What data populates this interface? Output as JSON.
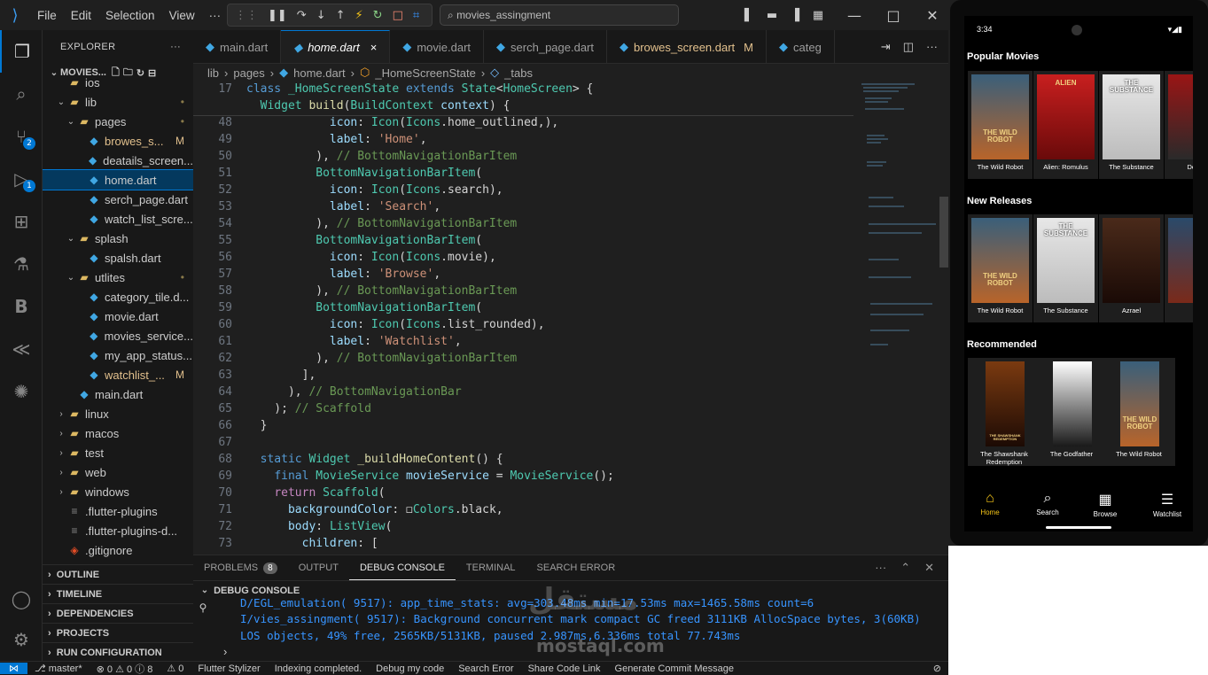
{
  "titlebar": {
    "menu": [
      "File",
      "Edit",
      "Selection",
      "View",
      "···"
    ],
    "search": "movies_assingment"
  },
  "explorer": {
    "title": "EXPLORER",
    "root": "MOVIES...",
    "rows": [
      {
        "indent": 2,
        "chev": "",
        "icon": "folder",
        "label": "ios",
        "mod": ""
      },
      {
        "indent": 2,
        "chev": "⌄",
        "icon": "folder",
        "label": "lib",
        "mod": "•"
      },
      {
        "indent": 3,
        "chev": "⌄",
        "icon": "folder",
        "label": "pages",
        "mod": "•"
      },
      {
        "indent": 4,
        "chev": "",
        "icon": "dart",
        "label": "browes_s...",
        "mod": "M"
      },
      {
        "indent": 4,
        "chev": "",
        "icon": "dart",
        "label": "deatails_screen...",
        "mod": ""
      },
      {
        "indent": 4,
        "chev": "",
        "icon": "dart",
        "label": "home.dart",
        "mod": "",
        "sel": true
      },
      {
        "indent": 4,
        "chev": "",
        "icon": "dart",
        "label": "serch_page.dart",
        "mod": ""
      },
      {
        "indent": 4,
        "chev": "",
        "icon": "dart",
        "label": "watch_list_scre...",
        "mod": ""
      },
      {
        "indent": 3,
        "chev": "⌄",
        "icon": "folder",
        "label": "splash",
        "mod": ""
      },
      {
        "indent": 4,
        "chev": "",
        "icon": "dart",
        "label": "spalsh.dart",
        "mod": ""
      },
      {
        "indent": 3,
        "chev": "⌄",
        "icon": "folder",
        "label": "utlites",
        "mod": "•"
      },
      {
        "indent": 4,
        "chev": "",
        "icon": "dart",
        "label": "category_tile.d...",
        "mod": ""
      },
      {
        "indent": 4,
        "chev": "",
        "icon": "dart",
        "label": "movie.dart",
        "mod": ""
      },
      {
        "indent": 4,
        "chev": "",
        "icon": "dart",
        "label": "movies_service...",
        "mod": ""
      },
      {
        "indent": 4,
        "chev": "",
        "icon": "dart",
        "label": "my_app_status...",
        "mod": ""
      },
      {
        "indent": 4,
        "chev": "",
        "icon": "dart",
        "label": "watchlist_...",
        "mod": "M"
      },
      {
        "indent": 3,
        "chev": "",
        "icon": "dart",
        "label": "main.dart",
        "mod": ""
      },
      {
        "indent": 2,
        "chev": "›",
        "icon": "folder",
        "label": "linux",
        "mod": ""
      },
      {
        "indent": 2,
        "chev": "›",
        "icon": "folder",
        "label": "macos",
        "mod": ""
      },
      {
        "indent": 2,
        "chev": "›",
        "icon": "folder",
        "label": "test",
        "mod": ""
      },
      {
        "indent": 2,
        "chev": "›",
        "icon": "folder",
        "label": "web",
        "mod": ""
      },
      {
        "indent": 2,
        "chev": "›",
        "icon": "folder",
        "label": "windows",
        "mod": ""
      },
      {
        "indent": 2,
        "chev": "",
        "icon": "file",
        "label": ".flutter-plugins",
        "mod": ""
      },
      {
        "indent": 2,
        "chev": "",
        "icon": "file",
        "label": ".flutter-plugins-d...",
        "mod": ""
      },
      {
        "indent": 2,
        "chev": "",
        "icon": "git",
        "label": ".gitignore",
        "mod": ""
      }
    ],
    "sections": [
      "OUTLINE",
      "TIMELINE",
      "DEPENDENCIES",
      "PROJECTS",
      "RUN CONFIGURATION"
    ]
  },
  "tabs": [
    {
      "label": "main.dart",
      "active": false
    },
    {
      "label": "home.dart",
      "active": true,
      "close": "×"
    },
    {
      "label": "movie.dart",
      "active": false
    },
    {
      "label": "serch_page.dart",
      "active": false
    },
    {
      "label": "browes_screen.dart",
      "active": false,
      "mod": "M"
    },
    {
      "label": "categ",
      "active": false
    }
  ],
  "breadcrumb": [
    "lib",
    "›",
    "pages",
    "›",
    "home.dart",
    "›",
    "_HomeScreenState",
    "›",
    "_tabs"
  ],
  "code": [
    {
      "n": "17",
      "t": [
        [
          "kw",
          "class "
        ],
        [
          "ty",
          "_HomeScreenState "
        ],
        [
          "kw",
          "extends "
        ],
        [
          "ty",
          "State"
        ],
        [
          "",
          "<"
        ],
        [
          "ty",
          "HomeScreen"
        ],
        [
          "",
          "> {"
        ]
      ]
    },
    {
      "n": "",
      "t": [
        [
          "",
          "  "
        ],
        [
          "ty",
          "Widget "
        ],
        [
          "fn",
          "build"
        ],
        [
          "",
          "("
        ],
        [
          "ty",
          "BuildContext "
        ],
        [
          "pr",
          "context"
        ],
        [
          "",
          ") {"
        ]
      ]
    },
    {
      "n": "48",
      "t": [
        [
          "",
          "            "
        ],
        [
          "pr",
          "icon"
        ],
        [
          "",
          ": "
        ],
        [
          "ty",
          "Icon"
        ],
        [
          "",
          "("
        ],
        [
          "ty",
          "Icons"
        ],
        [
          "",
          ".home_outlined,),"
        ]
      ]
    },
    {
      "n": "49",
      "t": [
        [
          "",
          "            "
        ],
        [
          "pr",
          "label"
        ],
        [
          "",
          ": "
        ],
        [
          "st",
          "'Home'"
        ],
        [
          "",
          ","
        ]
      ]
    },
    {
      "n": "50",
      "t": [
        [
          "",
          "          ), "
        ],
        [
          "cm",
          "// BottomNavigationBarItem"
        ]
      ]
    },
    {
      "n": "51",
      "t": [
        [
          "",
          "          "
        ],
        [
          "ty",
          "BottomNavigationBarItem"
        ],
        [
          "",
          "("
        ]
      ]
    },
    {
      "n": "52",
      "t": [
        [
          "",
          "            "
        ],
        [
          "pr",
          "icon"
        ],
        [
          "",
          ": "
        ],
        [
          "ty",
          "Icon"
        ],
        [
          "",
          "("
        ],
        [
          "ty",
          "Icons"
        ],
        [
          "",
          ".search),"
        ]
      ]
    },
    {
      "n": "53",
      "t": [
        [
          "",
          "            "
        ],
        [
          "pr",
          "label"
        ],
        [
          "",
          ": "
        ],
        [
          "st",
          "'Search'"
        ],
        [
          "",
          ","
        ]
      ]
    },
    {
      "n": "54",
      "t": [
        [
          "",
          "          ), "
        ],
        [
          "cm",
          "// BottomNavigationBarItem"
        ]
      ]
    },
    {
      "n": "55",
      "t": [
        [
          "",
          "          "
        ],
        [
          "ty",
          "BottomNavigationBarItem"
        ],
        [
          "",
          "("
        ]
      ]
    },
    {
      "n": "56",
      "t": [
        [
          "",
          "            "
        ],
        [
          "pr",
          "icon"
        ],
        [
          "",
          ": "
        ],
        [
          "ty",
          "Icon"
        ],
        [
          "",
          "("
        ],
        [
          "ty",
          "Icons"
        ],
        [
          "",
          ".movie),"
        ]
      ]
    },
    {
      "n": "57",
      "t": [
        [
          "",
          "            "
        ],
        [
          "pr",
          "label"
        ],
        [
          "",
          ": "
        ],
        [
          "st",
          "'Browse'"
        ],
        [
          "",
          ","
        ]
      ]
    },
    {
      "n": "58",
      "t": [
        [
          "",
          "          ), "
        ],
        [
          "cm",
          "// BottomNavigationBarItem"
        ]
      ]
    },
    {
      "n": "59",
      "t": [
        [
          "",
          "          "
        ],
        [
          "ty",
          "BottomNavigationBarItem"
        ],
        [
          "",
          "("
        ]
      ]
    },
    {
      "n": "60",
      "t": [
        [
          "",
          "            "
        ],
        [
          "pr",
          "icon"
        ],
        [
          "",
          ": "
        ],
        [
          "ty",
          "Icon"
        ],
        [
          "",
          "("
        ],
        [
          "ty",
          "Icons"
        ],
        [
          "",
          ".list_rounded),"
        ]
      ]
    },
    {
      "n": "61",
      "t": [
        [
          "",
          "            "
        ],
        [
          "pr",
          "label"
        ],
        [
          "",
          ": "
        ],
        [
          "st",
          "'Watchlist'"
        ],
        [
          "",
          ","
        ]
      ]
    },
    {
      "n": "62",
      "t": [
        [
          "",
          "          ), "
        ],
        [
          "cm",
          "// BottomNavigationBarItem"
        ]
      ]
    },
    {
      "n": "63",
      "t": [
        [
          "",
          "        ],"
        ]
      ]
    },
    {
      "n": "64",
      "t": [
        [
          "",
          "      ), "
        ],
        [
          "cm",
          "// BottomNavigationBar"
        ]
      ]
    },
    {
      "n": "65",
      "t": [
        [
          "",
          "    ); "
        ],
        [
          "cm",
          "// Scaffold"
        ]
      ]
    },
    {
      "n": "66",
      "t": [
        [
          "",
          "  }"
        ]
      ]
    },
    {
      "n": "67",
      "t": [
        [
          "",
          ""
        ]
      ]
    },
    {
      "n": "68",
      "t": [
        [
          "",
          "  "
        ],
        [
          "kw",
          "static "
        ],
        [
          "ty",
          "Widget "
        ],
        [
          "fn",
          "_buildHomeContent"
        ],
        [
          "",
          "() {"
        ]
      ]
    },
    {
      "n": "69",
      "t": [
        [
          "",
          "    "
        ],
        [
          "kw",
          "final "
        ],
        [
          "ty",
          "MovieService "
        ],
        [
          "pr",
          "movieService"
        ],
        [
          "",
          " = "
        ],
        [
          "ty",
          "MovieService"
        ],
        [
          "",
          "();"
        ]
      ]
    },
    {
      "n": "70",
      "t": [
        [
          "",
          "    "
        ],
        [
          "pk",
          "return "
        ],
        [
          "ty",
          "Scaffold"
        ],
        [
          "",
          "("
        ]
      ]
    },
    {
      "n": "71",
      "t": [
        [
          "",
          "      "
        ],
        [
          "pr",
          "backgroundColor"
        ],
        [
          "",
          ": ◻"
        ],
        [
          "ty",
          "Colors"
        ],
        [
          "",
          ".black,"
        ]
      ]
    },
    {
      "n": "72",
      "t": [
        [
          "",
          "      "
        ],
        [
          "pr",
          "body"
        ],
        [
          "",
          ": "
        ],
        [
          "ty",
          "ListView"
        ],
        [
          "",
          "("
        ]
      ]
    },
    {
      "n": "73",
      "t": [
        [
          "",
          "        "
        ],
        [
          "pr",
          "children"
        ],
        [
          "",
          ": ["
        ]
      ]
    }
  ],
  "panel": {
    "tabs": [
      {
        "label": "PROBLEMS",
        "badge": "8"
      },
      {
        "label": "OUTPUT"
      },
      {
        "label": "DEBUG CONSOLE",
        "active": true
      },
      {
        "label": "TERMINAL"
      },
      {
        "label": "SEARCH ERROR"
      }
    ],
    "header": "DEBUG CONSOLE",
    "lines": [
      "D/EGL_emulation( 9517): app_time_stats: avg=303.48ms min=17.53ms max=1465.58ms count=6",
      "I/vies_assingment( 9517): Background concurrent mark compact GC freed 3111KB AllocSpace bytes, 3(60KB)",
      "LOS objects, 49% free, 2565KB/5131KB, paused 2.987ms,6.336ms total 77.743ms"
    ]
  },
  "status": [
    "⎇ master*",
    "⊗ 0 ⚠ 0 ⓘ 8",
    "⚠ 0",
    "Flutter Stylizer",
    "Indexing completed.",
    "Debug my code",
    "Search Error",
    "Share Code Link",
    "Generate Commit Message"
  ],
  "phone": {
    "time": "3:34",
    "sections": [
      {
        "title": "Popular Movies",
        "items": [
          "The Wild Robot",
          "Alien: Romulus",
          "The Substance",
          "Deadp"
        ]
      },
      {
        "title": "New Releases",
        "items": [
          "The Wild Robot",
          "The Substance",
          "Azrael",
          "Te"
        ]
      },
      {
        "title": "Recommended",
        "items": [
          "The Shawshank Redemption",
          "The Godfather",
          "The Wild Robot"
        ]
      }
    ],
    "nav": [
      "Home",
      "Search",
      "Browse",
      "Watchlist"
    ],
    "poster_text": {
      "wild": "THE WILD ROBOT",
      "alien": "ALIEN",
      "substance": "THE SUBSTANCE",
      "shawshank": "THE SHAWSHANK REDEMPTION"
    }
  },
  "watermark": {
    "arabic": "مستقل",
    "latin": "mostaql.com"
  },
  "colors": {
    "accent": "#0078d4",
    "nav_active": "#f5c518"
  }
}
